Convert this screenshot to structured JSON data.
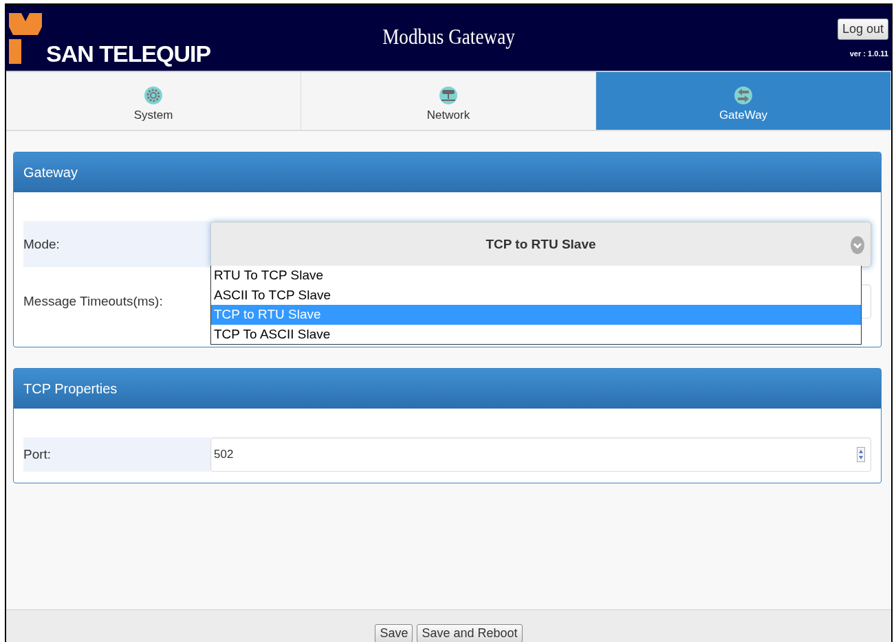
{
  "header": {
    "logo_text": "SAN TELEQUIP",
    "title": "Modbus Gateway",
    "logout_button": "Log out",
    "version": "ver : 1.0.11"
  },
  "tabs": [
    {
      "label": "System",
      "kind": "gear",
      "selected": false
    },
    {
      "label": "Network",
      "kind": "network",
      "selected": false
    },
    {
      "label": "GateWay",
      "kind": "arrows",
      "selected": true
    }
  ],
  "panels": [
    {
      "title": "Gateway",
      "fields": [
        {
          "label": "Mode:",
          "kind": "select",
          "value": "TCP to RTU Slave",
          "expanded": true,
          "options": [
            {
              "label": "RTU To TCP Slave",
              "selected": false
            },
            {
              "label": "ASCII To TCP Slave",
              "selected": false
            },
            {
              "label": "TCP to RTU Slave",
              "selected": true
            },
            {
              "label": "TCP To ASCII Slave",
              "selected": false
            }
          ]
        },
        {
          "label": "Message Timeouts(ms):",
          "kind": "text"
        }
      ]
    },
    {
      "title": "TCP Properties",
      "fields": [
        {
          "label": "Port:",
          "kind": "number",
          "value": "502"
        }
      ]
    }
  ],
  "footer": {
    "buttons": [
      "Save",
      "Save and Reboot"
    ]
  }
}
